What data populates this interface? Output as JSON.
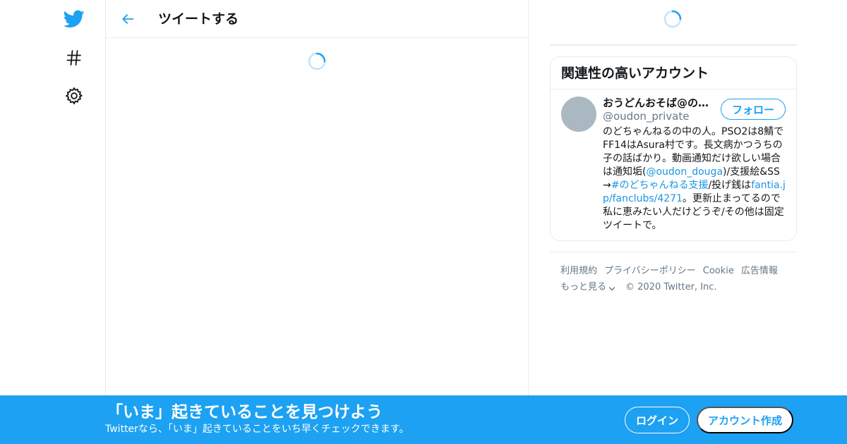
{
  "header": {
    "title": "ツイートする"
  },
  "icons": {
    "logo": "twitter-bird-icon",
    "explore": "hashtag-icon",
    "settings": "gear-icon",
    "back": "arrow-left-icon",
    "loading": "spinner-icon",
    "more": "chevron-down-icon"
  },
  "colors": {
    "accent": "#1da1f2",
    "link": "#1b95e0",
    "secondary_text": "#657786",
    "border": "#e6ecf0",
    "avatar_placeholder": "#aab8c2"
  },
  "sidebar": {
    "panel_title": "関連性の高いアカウント",
    "account": {
      "name": "おうどんおそば@のどちゃんねる",
      "handle": "@oudon_private",
      "follow_label": "フォロー",
      "bio": {
        "t1": "のどちゃんねるの中の人。PSO2は8鯖でFF14はAsura村です。長文病かつうちの子の話ばかり。動画通知だけ欲しい場合は通知垢(",
        "l1": "@oudon_douga",
        "t2": ")/支援絵&SS→",
        "l2": "#のどちゃんねる支援",
        "t3": "/投げ銭は",
        "l3": "fantia.jp/fanclubs/4271",
        "t4": "。更新止まってるので私に恵みたい人だけどうぞ/その他は固定ツイートで。"
      }
    }
  },
  "footer": {
    "links": [
      "利用規約",
      "プライバシーポリシー",
      "Cookie",
      "広告情報"
    ],
    "more": "もっと見る",
    "copyright": "© 2020 Twitter, Inc."
  },
  "banner": {
    "title": "「いま」起きていることを見つけよう",
    "subtitle": "Twitterなら、「いま」起きていることをいち早くチェックできます。",
    "login": "ログイン",
    "signup": "アカウント作成"
  }
}
